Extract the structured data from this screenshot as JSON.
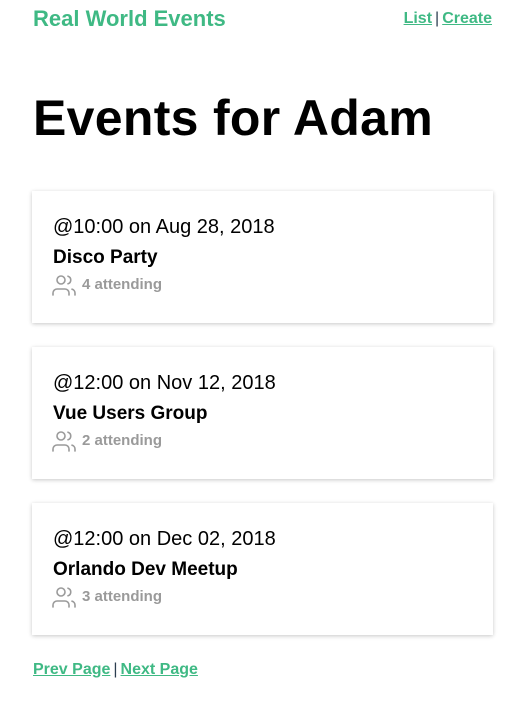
{
  "header": {
    "brand": "Real World Events",
    "nav": {
      "list": "List",
      "separator": "|",
      "create": "Create"
    }
  },
  "page_title": "Events for Adam",
  "events": [
    {
      "time": "@10:00 on Aug 28, 2018",
      "title": "Disco Party",
      "attending": "4 attending"
    },
    {
      "time": "@12:00 on Nov 12, 2018",
      "title": "Vue Users Group",
      "attending": "2 attending"
    },
    {
      "time": "@12:00 on Dec 02, 2018",
      "title": "Orlando Dev Meetup",
      "attending": "3 attending"
    }
  ],
  "pagination": {
    "prev": "Prev Page",
    "separator": "|",
    "next": "Next Page"
  },
  "icons": {
    "attendees": "users-icon"
  },
  "colors": {
    "brand": "#3fb984",
    "muted": "#9a9a9a",
    "nav_separator": "#2c3e50"
  }
}
